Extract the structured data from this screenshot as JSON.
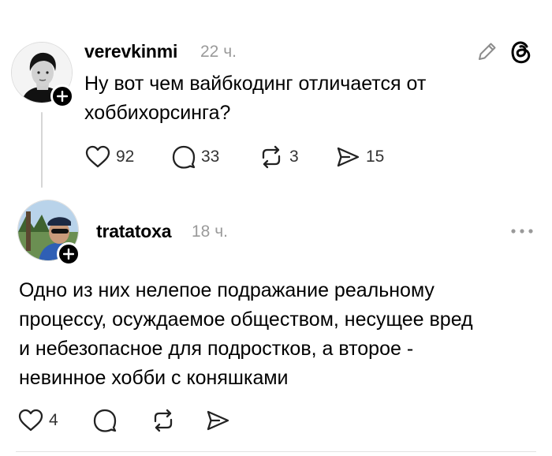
{
  "posts": [
    {
      "username": "verevkinmi",
      "time": "22 ч.",
      "text_lines": [
        "Ну вот чем вайбкодинг отличается от",
        "хоббихорсинга?"
      ],
      "likes": "92",
      "comments": "33",
      "reposts": "3",
      "shares": "15"
    },
    {
      "username": "tratatoxa",
      "time": "18 ч.",
      "text_lines": [
        "Одно из них нелепое подражание реальному",
        "процессу, осуждаемое обществом, несущее вред",
        "и небезопасное для подростков, а второе -",
        "невинное хобби с коняшками"
      ],
      "likes": "4"
    }
  ],
  "icons": {
    "edit": "pencil-icon",
    "app": "threads-logo-icon",
    "more": "more-dots-icon",
    "follow": "plus-icon",
    "like": "heart-icon",
    "comment": "comment-bubble-icon",
    "repost": "repost-icon",
    "share": "send-icon"
  }
}
